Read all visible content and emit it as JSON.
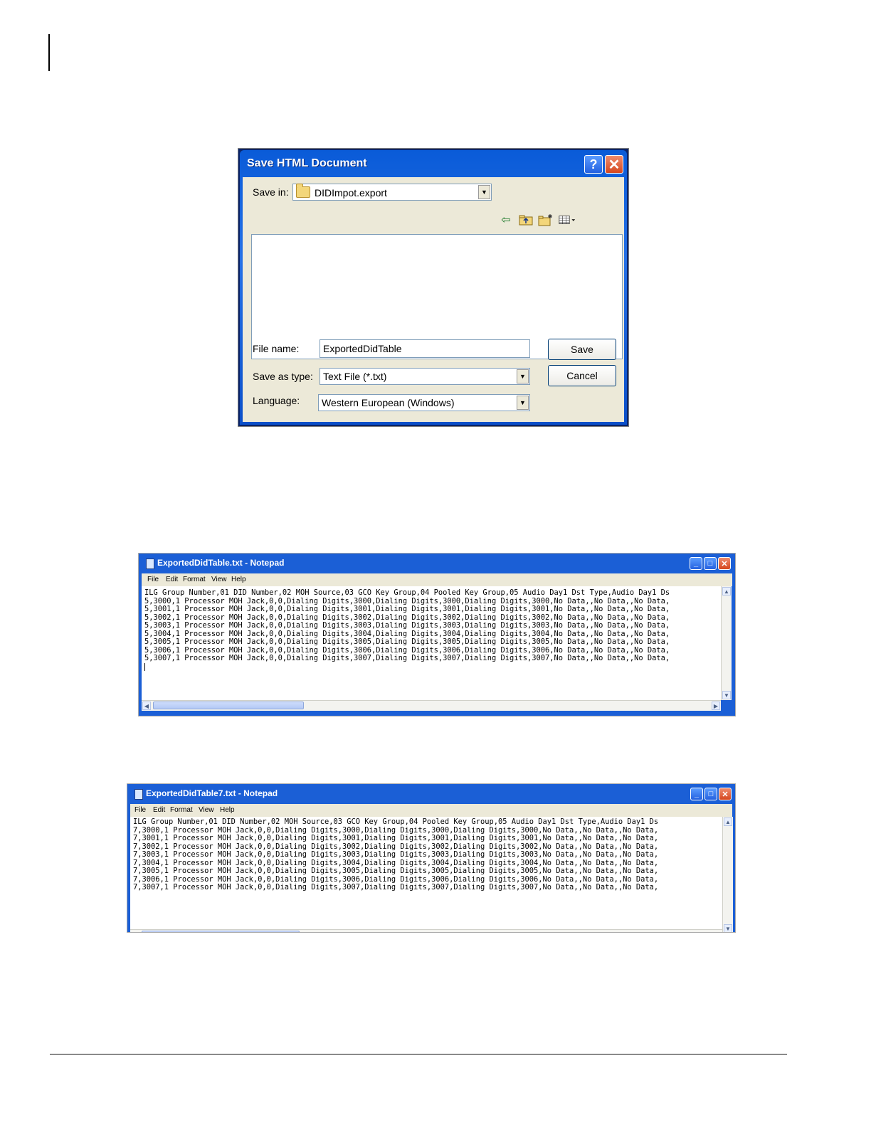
{
  "save_dialog": {
    "title": "Save HTML Document",
    "save_in_label": "Save in:",
    "save_in_value": "DIDImpot.export",
    "file_name_label": "File name:",
    "file_name_value": "ExportedDidTable",
    "save_as_type_label": "Save as type:",
    "save_as_type_value": "Text File (*.txt)",
    "language_label": "Language:",
    "language_value": "Western European (Windows)",
    "save_button": "Save",
    "cancel_button": "Cancel",
    "help_glyph": "?",
    "close_glyph": "✕",
    "toolbar_icons": [
      "back-arrow-icon",
      "up-folder-icon",
      "new-folder-icon",
      "views-menu-icon"
    ]
  },
  "notepad_1": {
    "title": "ExportedDidTable.txt - Notepad",
    "menu": [
      "File",
      "Edit",
      "Format",
      "View",
      "Help"
    ],
    "lines": [
      "ILG Group Number,01 DID Number,02 MOH Source,03 GCO Key Group,04 Pooled Key Group,05 Audio Day1 Dst Type,Audio Day1 Ds",
      "5,3000,1 Processor MOH Jack,0,0,Dialing Digits,3000,Dialing Digits,3000,Dialing Digits,3000,No Data,,No Data,,No Data,",
      "5,3001,1 Processor MOH Jack,0,0,Dialing Digits,3001,Dialing Digits,3001,Dialing Digits,3001,No Data,,No Data,,No Data,",
      "5,3002,1 Processor MOH Jack,0,0,Dialing Digits,3002,Dialing Digits,3002,Dialing Digits,3002,No Data,,No Data,,No Data,",
      "5,3003,1 Processor MOH Jack,0,0,Dialing Digits,3003,Dialing Digits,3003,Dialing Digits,3003,No Data,,No Data,,No Data,",
      "5,3004,1 Processor MOH Jack,0,0,Dialing Digits,3004,Dialing Digits,3004,Dialing Digits,3004,No Data,,No Data,,No Data,",
      "5,3005,1 Processor MOH Jack,0,0,Dialing Digits,3005,Dialing Digits,3005,Dialing Digits,3005,No Data,,No Data,,No Data,",
      "5,3006,1 Processor MOH Jack,0,0,Dialing Digits,3006,Dialing Digits,3006,Dialing Digits,3006,No Data,,No Data,,No Data,",
      "5,3007,1 Processor MOH Jack,0,0,Dialing Digits,3007,Dialing Digits,3007,Dialing Digits,3007,No Data,,No Data,,No Data,"
    ]
  },
  "notepad_2": {
    "title": "ExportedDidTable7.txt - Notepad",
    "menu": [
      "File",
      "Edit",
      "Format",
      "View",
      "Help"
    ],
    "lines": [
      "ILG Group Number,01 DID Number,02 MOH Source,03 GCO Key Group,04 Pooled Key Group,05 Audio Day1 Dst Type,Audio Day1 Ds",
      "7,3000,1 Processor MOH Jack,0,0,Dialing Digits,3000,Dialing Digits,3000,Dialing Digits,3000,No Data,,No Data,,No Data,",
      "7,3001,1 Processor MOH Jack,0,0,Dialing Digits,3001,Dialing Digits,3001,Dialing Digits,3001,No Data,,No Data,,No Data,",
      "7,3002,1 Processor MOH Jack,0,0,Dialing Digits,3002,Dialing Digits,3002,Dialing Digits,3002,No Data,,No Data,,No Data,",
      "7,3003,1 Processor MOH Jack,0,0,Dialing Digits,3003,Dialing Digits,3003,Dialing Digits,3003,No Data,,No Data,,No Data,",
      "7,3004,1 Processor MOH Jack,0,0,Dialing Digits,3004,Dialing Digits,3004,Dialing Digits,3004,No Data,,No Data,,No Data,",
      "7,3005,1 Processor MOH Jack,0,0,Dialing Digits,3005,Dialing Digits,3005,Dialing Digits,3005,No Data,,No Data,,No Data,",
      "7,3006,1 Processor MOH Jack,0,0,Dialing Digits,3006,Dialing Digits,3006,Dialing Digits,3006,No Data,,No Data,,No Data,",
      "7,3007,1 Processor MOH Jack,0,0,Dialing Digits,3007,Dialing Digits,3007,Dialing Digits,3007,No Data,,No Data,,No Data,"
    ]
  },
  "window_glyphs": {
    "minimize": "_",
    "maximize": "□",
    "close": "✕"
  },
  "colors": {
    "xp_title_blue": "#0a5bd8",
    "dialog_face": "#ece9d8",
    "close_red": "#d5471f"
  }
}
